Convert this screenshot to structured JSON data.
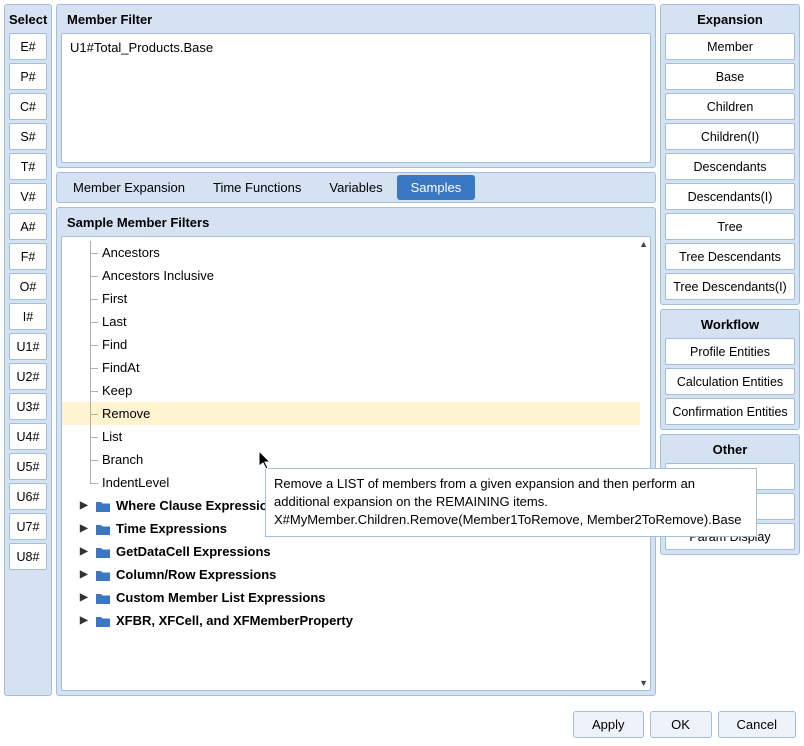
{
  "select": {
    "header": "Select",
    "buttons": [
      "E#",
      "P#",
      "C#",
      "S#",
      "T#",
      "V#",
      "A#",
      "F#",
      "O#",
      "I#",
      "U1#",
      "U2#",
      "U3#",
      "U4#",
      "U5#",
      "U6#",
      "U7#",
      "U8#"
    ]
  },
  "memberFilter": {
    "header": "Member Filter",
    "value": "U1#Total_Products.Base"
  },
  "tabs": {
    "items": [
      "Member Expansion",
      "Time Functions",
      "Variables",
      "Samples"
    ],
    "active": "Samples"
  },
  "samples": {
    "header": "Sample Member Filters",
    "treeItems": [
      "Ancestors",
      "Ancestors Inclusive",
      "First",
      "Last",
      "Find",
      "FindAt",
      "Keep",
      "Remove",
      "List",
      "Branch",
      "IndentLevel"
    ],
    "highlighted": "Remove",
    "folders": [
      "Where Clause Expressions",
      "Time Expressions",
      "GetDataCell Expressions",
      "Column/Row Expressions",
      "Custom Member List Expressions",
      "XFBR, XFCell, and XFMemberProperty"
    ]
  },
  "tooltip": {
    "line1": "Remove a LIST of members from a given expansion and then perform an additional expansion on the REMAINING items.",
    "line2": "X#MyMember.Children.Remove(Member1ToRemove, Member2ToRemove).Base"
  },
  "expansion": {
    "header": "Expansion",
    "buttons": [
      "Member",
      "Base",
      "Children",
      "Children(I)",
      "Descendants",
      "Descendants(I)",
      "Tree",
      "Tree Descendants",
      "Tree Descendants(I)"
    ]
  },
  "workflow": {
    "header": "Workflow",
    "buttons": [
      "Profile Entities",
      "Calculation Entities",
      "Confirmation Entities"
    ]
  },
  "other": {
    "header": "Other",
    "buttons": [
      "",
      "",
      "Param Display"
    ]
  },
  "bottomButtons": {
    "apply": "Apply",
    "ok": "OK",
    "cancel": "Cancel"
  }
}
